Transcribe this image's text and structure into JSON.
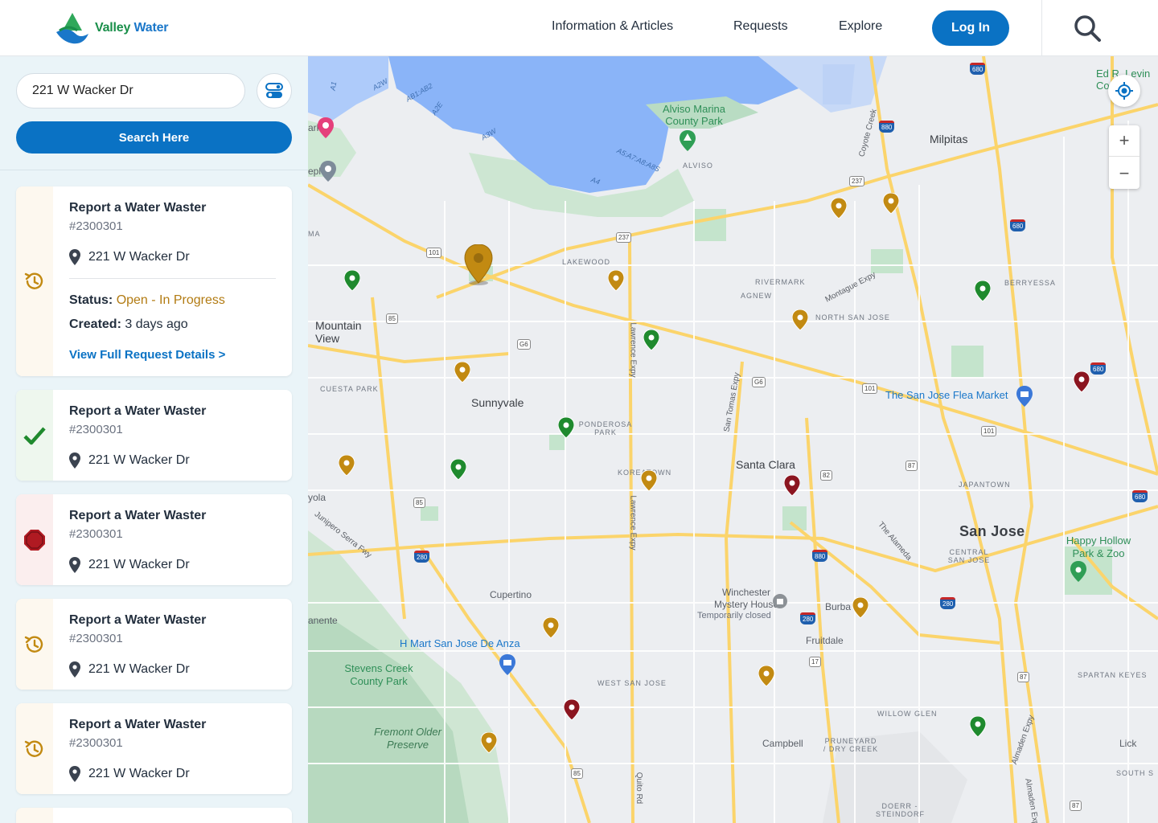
{
  "brand": {
    "name_part1": "Valley",
    "name_part2": "Water"
  },
  "nav": {
    "items": [
      "Information & Articles",
      "Requests",
      "Explore"
    ],
    "login_label": "Log In"
  },
  "search": {
    "value": "221 W Wacker Dr",
    "button_label": "Search Here"
  },
  "requests": [
    {
      "title": "Report a Water Waster",
      "id": "#2300301",
      "address": "221 W Wacker Dr",
      "state": "in-progress",
      "status_label": "Status:",
      "status_value": "Open - In Progress",
      "created_label": "Created:",
      "created_value": "3 days ago",
      "link_label": "View Full Request Details >"
    },
    {
      "title": "Report a Water Waster",
      "id": "#2300301",
      "address": "221 W Wacker Dr",
      "state": "done"
    },
    {
      "title": "Report a Water Waster",
      "id": "#2300301",
      "address": "221 W Wacker Dr",
      "state": "stopped"
    },
    {
      "title": "Report a Water Waster",
      "id": "#2300301",
      "address": "221 W Wacker Dr",
      "state": "in-progress"
    },
    {
      "title": "Report a Water Waster",
      "id": "#2300301",
      "address": "221 W Wacker Dr",
      "state": "in-progress"
    }
  ],
  "colors": {
    "brand_blue": "#0a72c4",
    "in_progress": "#c28a12",
    "done": "#1f8a2e",
    "stopped": "#8b1520"
  },
  "map": {
    "labels": {
      "milpitas": "Milpitas",
      "alviso_park": "Alviso Marina County Park",
      "alviso": "ALVISO",
      "mountain_view": "Mountain View",
      "sunnyvale": "Sunnyvale",
      "santa_clara": "Santa Clara",
      "san_jose": "San Jose",
      "cupertino": "Cupertino",
      "campbell": "Campbell",
      "fruitdale": "Fruitdale",
      "lakewood": "LAKEWOOD",
      "rivermark": "RIVERMARK",
      "agnew": "AGNEW",
      "north_san_jose": "NORTH SAN JOSE",
      "berryessa": "BERRYESSA",
      "cuesta_park": "CUESTA PARK",
      "ponderosa_park": "PONDEROSA PARK",
      "koreatown": "KOREATOWN",
      "japantown": "JAPANTOWN",
      "central_san_jose": "CENTRAL SAN JOSE",
      "west_san_jose": "WEST SAN JOSE",
      "willow_glen": "WILLOW GLEN",
      "pruneyard": "PRUNEYARD / DRY CREEK",
      "spartan_keyes": "SPARTAN KEYES",
      "doerr": "DOERR - STEINDORF",
      "flea_market": "The San Jose Flea Market",
      "hmart": "H Mart San Jose De Anza",
      "winchester": "Winchester Mystery House",
      "temporarily_closed": "Temporarily closed",
      "happy_hollow": "Happy Hollow Park & Zoo",
      "stevens_creek": "Stevens Creek County Park",
      "fremont_older": "Fremont Older Preserve",
      "burba": "Burba",
      "lick": "Lick",
      "south": "SOUTH S",
      "ed_levin": "Ed R. Levin Co",
      "ark": "ark",
      "eplex": "eplex",
      "yola": "yola",
      "anente": "anente",
      "ma": "MA",
      "montague": "Montague Expy",
      "lawrence1": "Lawrence Expy",
      "lawrence2": "Lawrence Expy",
      "san_tomas": "San Tomas Expy",
      "alameda": "The Alameda",
      "junipero": "Junipero Serra Fwy",
      "coyote": "Coyote Creek",
      "quito": "Quito Rd",
      "almaden": "Almaden Expy",
      "almaden2": "Almaden Expy",
      "a1": "A1",
      "a2w": "A2W",
      "a1ab2": "AB1:AB2",
      "a2e": "A2E",
      "a3w": "A3W",
      "a5": "A5:A7:A8:A8S",
      "a4": "A4"
    },
    "shields": [
      "680",
      "880",
      "237",
      "101",
      "85",
      "G6",
      "G6",
      "237",
      "101",
      "82",
      "87",
      "85",
      "280",
      "880",
      "280",
      "17",
      "85",
      "87",
      "101",
      "680",
      "680",
      "280",
      "280",
      "87",
      "680"
    ],
    "zoom_in": "+",
    "zoom_out": "−"
  }
}
